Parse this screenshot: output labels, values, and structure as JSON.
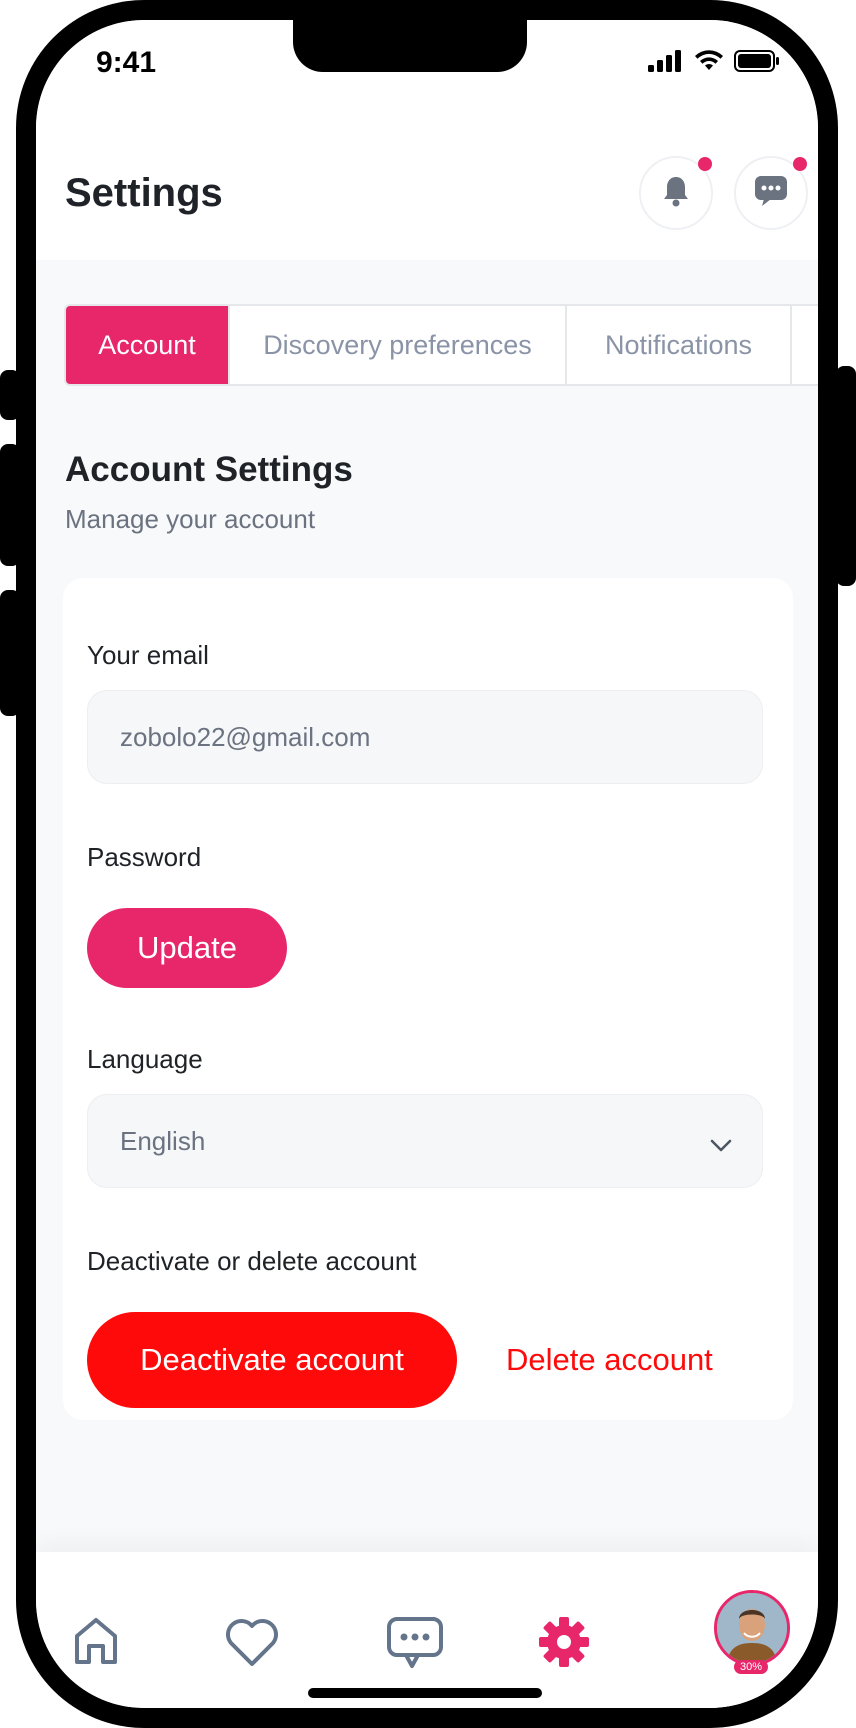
{
  "status": {
    "time": "9:41"
  },
  "header": {
    "title": "Settings"
  },
  "tabs": [
    {
      "label": "Account",
      "active": true
    },
    {
      "label": "Discovery preferences",
      "active": false
    },
    {
      "label": "Notifications",
      "active": false
    }
  ],
  "section": {
    "title": "Account Settings",
    "subtitle": "Manage your account"
  },
  "form": {
    "email_label": "Your email",
    "email_value": "zobolo22@gmail.com",
    "password_label": "Password",
    "update_button": "Update",
    "language_label": "Language",
    "language_value": "English",
    "deactivate_label": "Deactivate or delete account",
    "deactivate_button": "Deactivate account",
    "delete_link": "Delete account"
  },
  "nav": {
    "items": [
      "home-icon",
      "heart-icon",
      "chat-icon",
      "gear-icon",
      "avatar"
    ],
    "active": "gear-icon",
    "profile_completion": "30%"
  },
  "colors": {
    "accent": "#e8276b",
    "danger": "#ff0a0a",
    "text": "#1f2328",
    "muted": "#6b7280"
  }
}
